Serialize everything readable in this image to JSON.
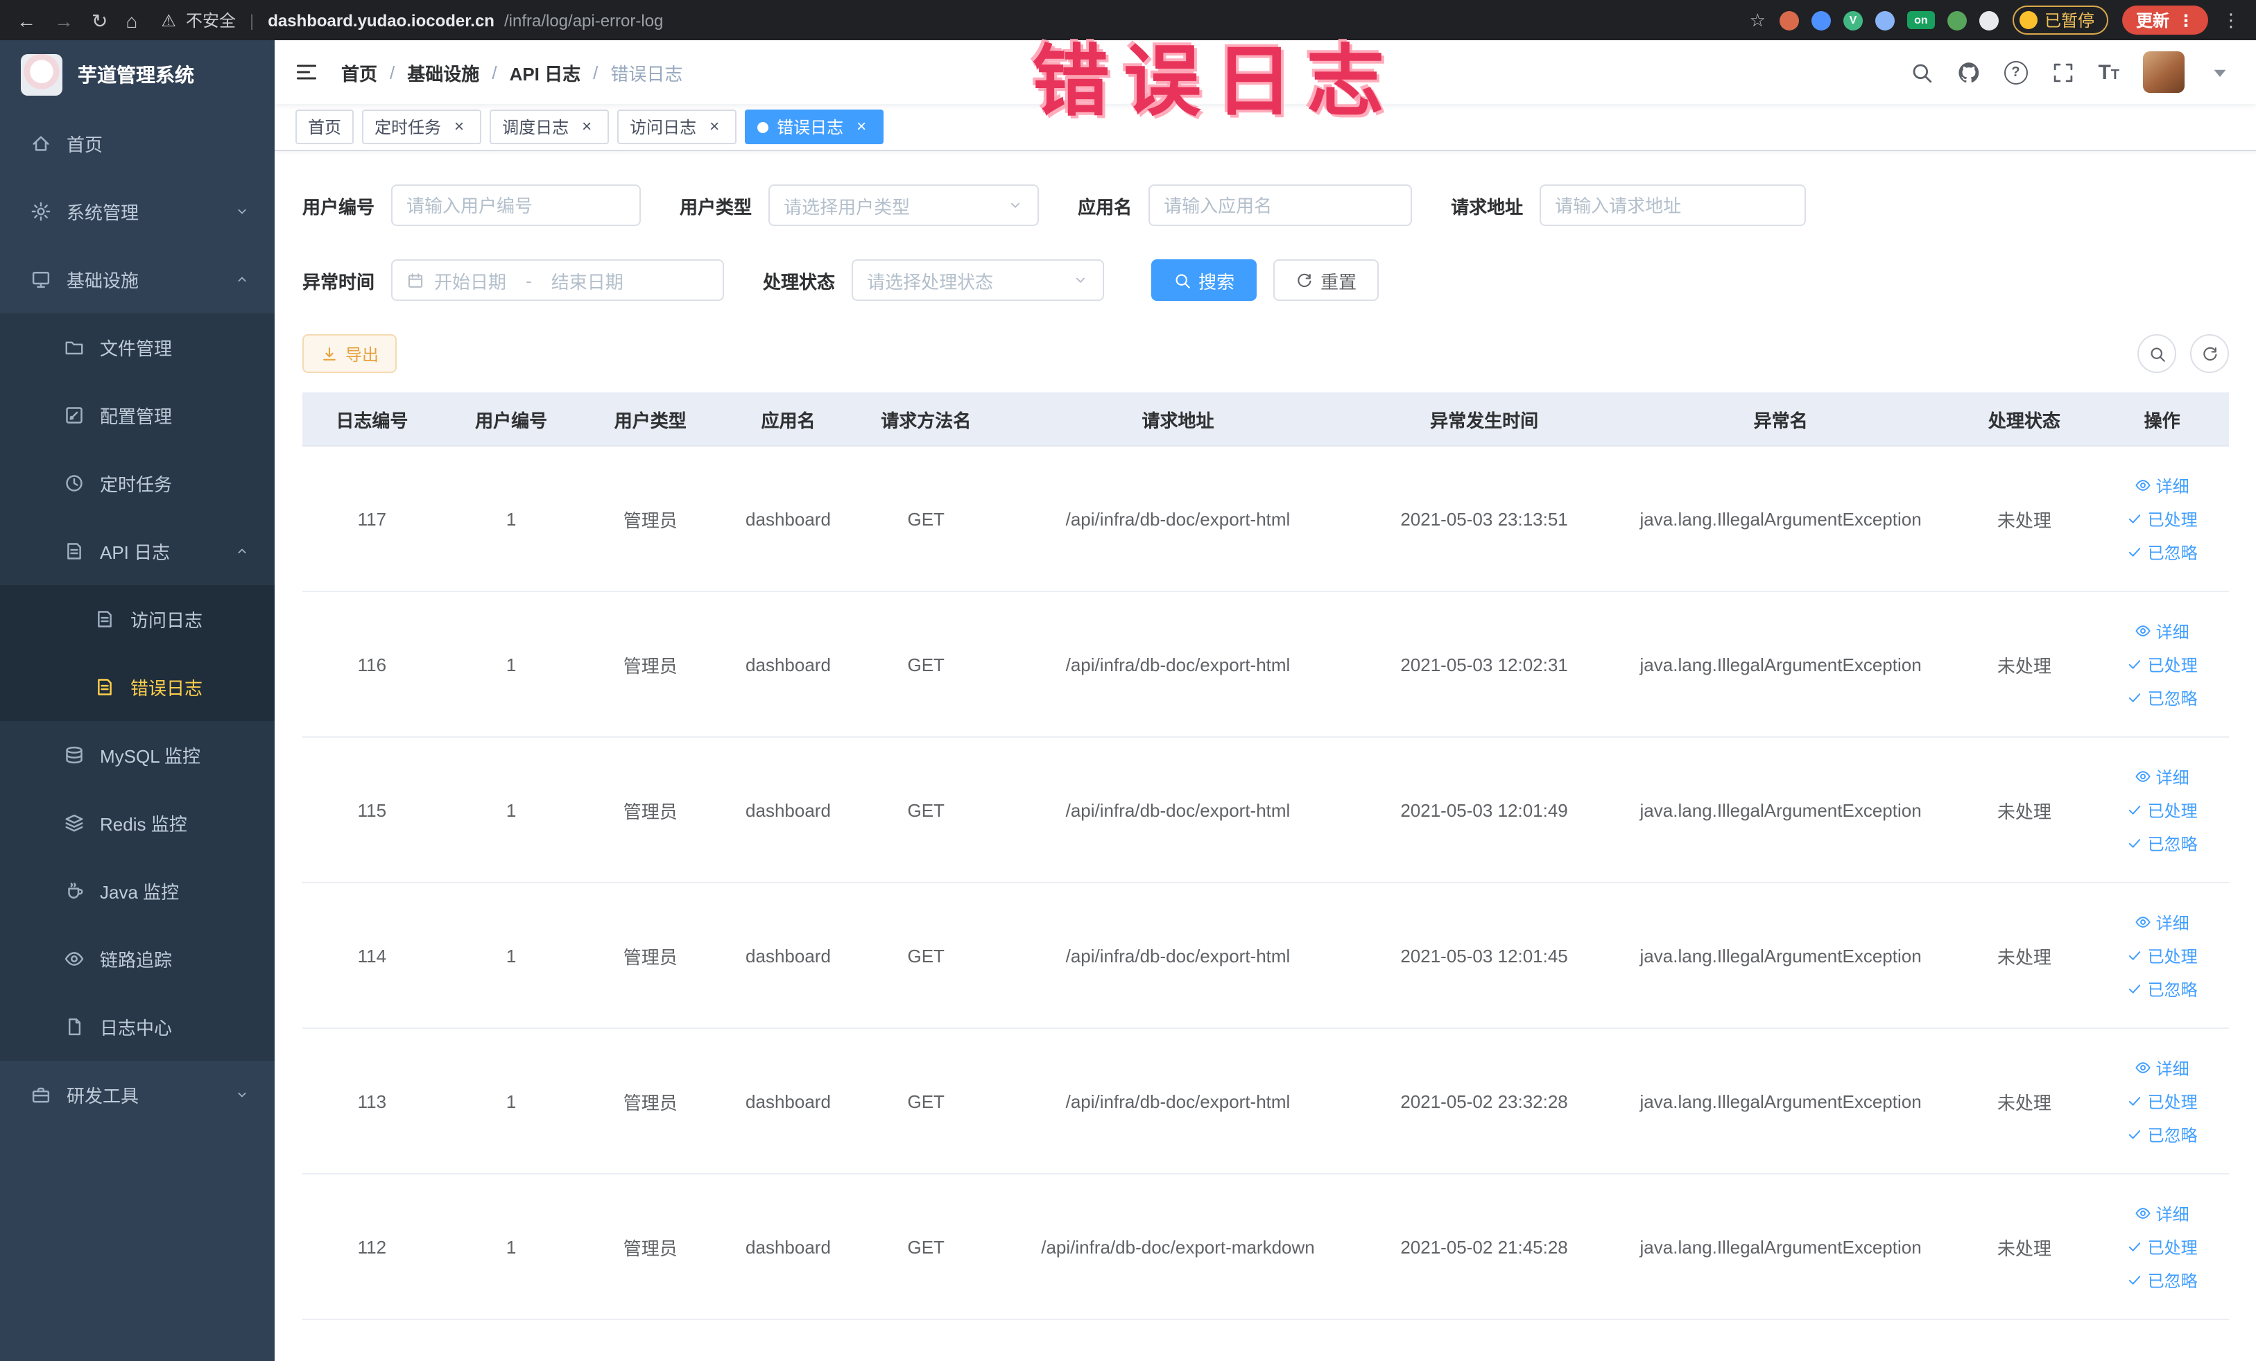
{
  "browser": {
    "security_label": "不安全",
    "url_domain": "dashboard.yudao.iocoder.cn",
    "url_path": "/infra/log/api-error-log",
    "paused_badge": "已暂停",
    "update_button": "更新",
    "extension_icons": [
      {
        "name": "extension-puzzle",
        "color": "#d96a4b",
        "text": ""
      },
      {
        "name": "extension-drop",
        "color": "#4d90fe",
        "text": ""
      },
      {
        "name": "extension-vue",
        "color": "#41b883",
        "text": "V"
      },
      {
        "name": "extension-grid",
        "color": "#8ab4f8",
        "text": ""
      },
      {
        "name": "extension-on-badge",
        "color": "#18a05e",
        "text": "on"
      },
      {
        "name": "extension-leaf",
        "color": "#58a55c",
        "text": ""
      },
      {
        "name": "extension-paw",
        "color": "#e8eaed",
        "text": ""
      }
    ]
  },
  "annotation": "错误日志",
  "sidebar": {
    "logo_title": "芋道管理系统",
    "items": [
      {
        "key": "home",
        "label": "首页",
        "icon": "home",
        "level": 1
      },
      {
        "key": "system",
        "label": "系统管理",
        "icon": "gear",
        "level": 1,
        "arrow": "down"
      },
      {
        "key": "infra",
        "label": "基础设施",
        "icon": "grid",
        "level": 1,
        "arrow": "up"
      },
      {
        "key": "file",
        "label": "文件管理",
        "icon": "folder",
        "level": 2
      },
      {
        "key": "config",
        "label": "配置管理",
        "icon": "edit",
        "level": 2
      },
      {
        "key": "job",
        "label": "定时任务",
        "icon": "clock",
        "level": 2
      },
      {
        "key": "api-log",
        "label": "API 日志",
        "icon": "document",
        "level": 2,
        "arrow": "up"
      },
      {
        "key": "access-log",
        "label": "访问日志",
        "icon": "document",
        "level": 3
      },
      {
        "key": "error-log",
        "label": "错误日志",
        "icon": "document",
        "level": 3,
        "active": true
      },
      {
        "key": "mysql",
        "label": "MySQL 监控",
        "icon": "database",
        "level": 2
      },
      {
        "key": "redis",
        "label": "Redis 监控",
        "icon": "layers",
        "level": 2
      },
      {
        "key": "java",
        "label": "Java 监控",
        "icon": "coffee",
        "level": 2
      },
      {
        "key": "trace",
        "label": "链路追踪",
        "icon": "eye",
        "level": 2
      },
      {
        "key": "log-center",
        "label": "日志中心",
        "icon": "documents",
        "level": 2
      },
      {
        "key": "dev-tools",
        "label": "研发工具",
        "icon": "briefcase",
        "level": 1,
        "arrow": "down"
      }
    ]
  },
  "navbar": {
    "breadcrumb": [
      "首页",
      "基础设施",
      "API 日志",
      "错误日志"
    ]
  },
  "tabs": [
    {
      "label": "首页",
      "closable": false,
      "active": false
    },
    {
      "label": "定时任务",
      "closable": true,
      "active": false
    },
    {
      "label": "调度日志",
      "closable": true,
      "active": false
    },
    {
      "label": "访问日志",
      "closable": true,
      "active": false
    },
    {
      "label": "错误日志",
      "closable": true,
      "active": true
    }
  ],
  "filters": {
    "user_id": {
      "label": "用户编号",
      "placeholder": "请输入用户编号"
    },
    "user_type": {
      "label": "用户类型",
      "placeholder": "请选择用户类型"
    },
    "app_name": {
      "label": "应用名",
      "placeholder": "请输入应用名"
    },
    "request_url": {
      "label": "请求地址",
      "placeholder": "请输入请求地址"
    },
    "exception_time": {
      "label": "异常时间",
      "start_placeholder": "开始日期",
      "separator": "-",
      "end_placeholder": "结束日期"
    },
    "process_status": {
      "label": "处理状态",
      "placeholder": "请选择处理状态"
    },
    "search_button": "搜索",
    "reset_button": "重置"
  },
  "toolbar": {
    "export_button": "导出"
  },
  "table": {
    "columns": [
      "日志编号",
      "用户编号",
      "用户类型",
      "应用名",
      "请求方法名",
      "请求地址",
      "异常发生时间",
      "异常名",
      "处理状态",
      "操作"
    ],
    "actions": [
      "详细",
      "已处理",
      "已忽略"
    ],
    "rows": [
      {
        "id": "117",
        "user_id": "1",
        "user_type": "管理员",
        "app_name": "dashboard",
        "method": "GET",
        "url": "/api/infra/db-doc/export-html",
        "time": "2021-05-03 23:13:51",
        "exception": "java.lang.IllegalArgumentException",
        "status": "未处理"
      },
      {
        "id": "116",
        "user_id": "1",
        "user_type": "管理员",
        "app_name": "dashboard",
        "method": "GET",
        "url": "/api/infra/db-doc/export-html",
        "time": "2021-05-03 12:02:31",
        "exception": "java.lang.IllegalArgumentException",
        "status": "未处理"
      },
      {
        "id": "115",
        "user_id": "1",
        "user_type": "管理员",
        "app_name": "dashboard",
        "method": "GET",
        "url": "/api/infra/db-doc/export-html",
        "time": "2021-05-03 12:01:49",
        "exception": "java.lang.IllegalArgumentException",
        "status": "未处理"
      },
      {
        "id": "114",
        "user_id": "1",
        "user_type": "管理员",
        "app_name": "dashboard",
        "method": "GET",
        "url": "/api/infra/db-doc/export-html",
        "time": "2021-05-03 12:01:45",
        "exception": "java.lang.IllegalArgumentException",
        "status": "未处理"
      },
      {
        "id": "113",
        "user_id": "1",
        "user_type": "管理员",
        "app_name": "dashboard",
        "method": "GET",
        "url": "/api/infra/db-doc/export-html",
        "time": "2021-05-02 23:32:28",
        "exception": "java.lang.IllegalArgumentException",
        "status": "未处理"
      },
      {
        "id": "112",
        "user_id": "1",
        "user_type": "管理员",
        "app_name": "dashboard",
        "method": "GET",
        "url": "/api/infra/db-doc/export-markdown",
        "time": "2021-05-02 21:45:28",
        "exception": "java.lang.IllegalArgumentException",
        "status": "未处理"
      }
    ]
  }
}
